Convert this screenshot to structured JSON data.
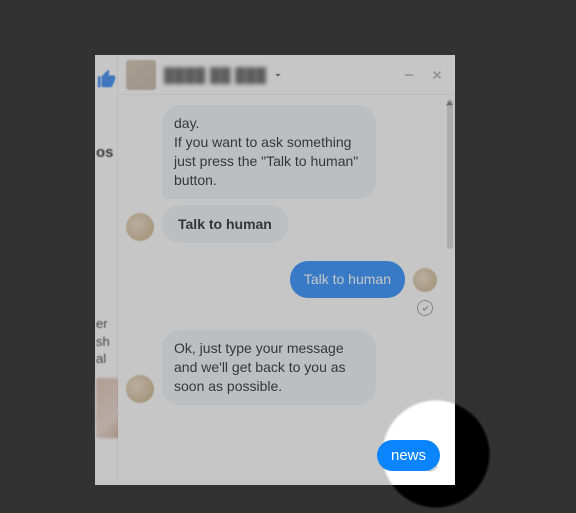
{
  "background": {
    "like_icon": "thumbs-up",
    "os_fragment": "os",
    "side_text": "er\nsh\nal"
  },
  "chat": {
    "header": {
      "title": "████ ██ ███",
      "has_dropdown": true
    },
    "messages": {
      "bot_intro": "day.\n If you want to ask something just press the \"Talk to human\" button.",
      "quick_reply_in": "Talk to human",
      "user_reply": "Talk to human",
      "bot_ack": "Ok, just type your message and we'll get back to you as soon as possible.",
      "user_reply_2": "news"
    }
  }
}
